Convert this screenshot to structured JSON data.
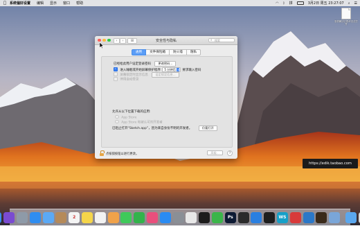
{
  "menubar": {
    "app_name": "系统偏好设置",
    "items": [
      "编辑",
      "显示",
      "窗口",
      "帮助"
    ],
    "input_method": "拼",
    "clock": "3月2日 周五 23:27:07"
  },
  "desktop_file": {
    "name": "怎样解决已损坏无法打开"
  },
  "window": {
    "title": "安全性与隐私",
    "search_placeholder": "搜索",
    "tabs": [
      {
        "label": "通用",
        "active": true
      },
      {
        "label": "文件保险箱",
        "active": false
      },
      {
        "label": "防火墙",
        "active": false
      },
      {
        "label": "隐私",
        "active": false
      }
    ],
    "login_password_set": "已经给此用户设定登录密码",
    "change_password_button": "更改密码…",
    "require_password_label": "进入睡眠或开始屏幕保护程序",
    "require_password_delay": "5 分钟后",
    "require_password_suffix": "要求输入密码",
    "show_message_label": "屏幕锁定时显示信息",
    "set_lock_message_button": "设定锁定信息…",
    "disable_auto_login_label": "停用自动登录",
    "allow_apps_heading": "允许从以下位置下载的应用:",
    "app_store_option": "App Store",
    "app_store_dev_option": "App Store 和被认可的开发者",
    "blocked_message": "已阻止打开“Sketch.app”，因为来自身份不明的开发者。",
    "open_anyway_button": "仍要打开",
    "lock_text": "点按锁按钮以进行更改。",
    "advanced_button": "高级…",
    "help_button": "?"
  },
  "tooltip": {
    "text": "https://edik.taobao.com"
  },
  "dock": {
    "items": [
      {
        "name": "finder-icon",
        "color": "#3a8ef2"
      },
      {
        "name": "siri-icon",
        "color": "#7a4bd1"
      },
      {
        "name": "launchpad-icon",
        "color": "#8e9aa8"
      },
      {
        "name": "safari-icon",
        "color": "#2f8df0"
      },
      {
        "name": "mail-icon",
        "color": "#5ba9f5"
      },
      {
        "name": "contacts-icon",
        "color": "#b58a5a"
      },
      {
        "name": "calendar-icon",
        "color": "#f4f4f4",
        "label": "2"
      },
      {
        "name": "notes-icon",
        "color": "#f5d54a"
      },
      {
        "name": "reminders-icon",
        "color": "#f2f2f2"
      },
      {
        "name": "photos-icon",
        "color": "#f0a24a"
      },
      {
        "name": "messages-icon",
        "color": "#3fc95a"
      },
      {
        "name": "facetime-icon",
        "color": "#32b34b"
      },
      {
        "name": "itunes-icon",
        "color": "#e94f7c"
      },
      {
        "name": "app-store-icon",
        "color": "#2a8bf2"
      },
      {
        "name": "system-preferences-icon",
        "color": "#8a8f96"
      },
      {
        "name": "chrome-icon",
        "color": "#e8e8e8"
      },
      {
        "name": "qq-icon",
        "color": "#1c1c1c"
      },
      {
        "name": "wechat-icon",
        "color": "#3bb54a"
      },
      {
        "name": "photoshop-icon",
        "color": "#0d1a33",
        "label": "Ps"
      },
      {
        "name": "terminal-icon",
        "color": "#2b2b2b"
      },
      {
        "name": "xcode-icon",
        "color": "#2a7fe0"
      },
      {
        "name": "sketch-icon",
        "color": "#1e1e1e"
      },
      {
        "name": "webstorm-icon",
        "color": "#16a0c8",
        "label": "WS"
      },
      {
        "name": "netease-music-icon",
        "color": "#d83a3a"
      },
      {
        "name": "visual-studio-code-icon",
        "color": "#2b78c8"
      },
      {
        "name": "illustrator-icon",
        "color": "#3a2a1a"
      },
      {
        "name": "preview-icon",
        "color": "#7aa6d8"
      },
      {
        "name": "finder-folder-icon",
        "color": "#5aa7ee"
      },
      {
        "name": "trash-icon",
        "color": "#d9d9d9"
      }
    ]
  }
}
